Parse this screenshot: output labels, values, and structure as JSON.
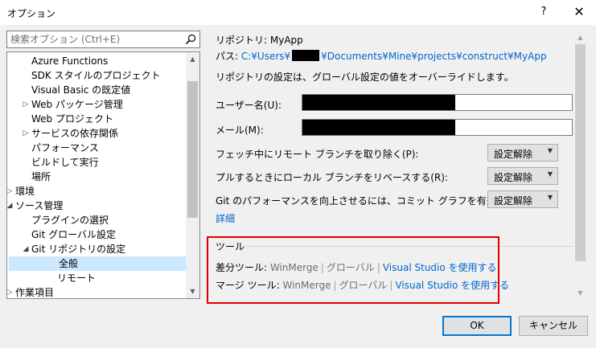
{
  "window": {
    "title": "オプション",
    "help_glyph": "?",
    "close_glyph": "✕"
  },
  "search": {
    "placeholder": "検索オプション (Ctrl+E)"
  },
  "tree": {
    "items": [
      {
        "label": "Azure Functions",
        "indent": 2,
        "expander": "",
        "selected": false
      },
      {
        "label": "SDK スタイルのプロジェクト",
        "indent": 2,
        "expander": "",
        "selected": false
      },
      {
        "label": "Visual Basic の既定値",
        "indent": 2,
        "expander": "",
        "selected": false
      },
      {
        "label": "Web パッケージ管理",
        "indent": 2,
        "expander": "▷",
        "selected": false
      },
      {
        "label": "Web プロジェクト",
        "indent": 2,
        "expander": "",
        "selected": false
      },
      {
        "label": "サービスの依存関係",
        "indent": 2,
        "expander": "▷",
        "selected": false
      },
      {
        "label": "パフォーマンス",
        "indent": 2,
        "expander": "",
        "selected": false
      },
      {
        "label": "ビルドして実行",
        "indent": 2,
        "expander": "",
        "selected": false
      },
      {
        "label": "場所",
        "indent": 2,
        "expander": "",
        "selected": false
      },
      {
        "label": "環境",
        "indent": 1,
        "expander": "▷",
        "selected": false
      },
      {
        "label": "ソース管理",
        "indent": 1,
        "expander": "◢",
        "selected": false
      },
      {
        "label": "プラグインの選択",
        "indent": 2,
        "expander": "",
        "selected": false
      },
      {
        "label": "Git グローバル設定",
        "indent": 2,
        "expander": "",
        "selected": false
      },
      {
        "label": "Git リポジトリの設定",
        "indent": 2,
        "expander": "◢",
        "selected": false
      },
      {
        "label": "全般",
        "indent": 3,
        "expander": "",
        "selected": true
      },
      {
        "label": "リモート",
        "indent": 3,
        "expander": "",
        "selected": false
      },
      {
        "label": "作業項目",
        "indent": 1,
        "expander": "▷",
        "selected": false
      }
    ]
  },
  "repo": {
    "repository_line": "リポジトリ: MyApp",
    "path_label": "パス:",
    "path_prefix": "C:¥Users¥",
    "path_suffix": "¥Documents¥Mine¥projects¥construct¥MyApp",
    "override_note": "リポジトリの設定は、グローバル設定の値をオーバーライドします。",
    "user_name_label": "ユーザー名(U):",
    "email_label": "メール(M):",
    "fetch_prune_label": "フェッチ中にリモート ブランチを取り除く(P):",
    "pull_rebase_label": "プルするときにローカル ブランチをリベースする(R):",
    "commit_graph_label": "Git のパフォーマンスを向上させるには、コミット グラフを有効にします(E):",
    "unset_value": "設定解除",
    "details_link": "詳細"
  },
  "tools": {
    "section_label": "ツール",
    "diff_label": "差分ツール:",
    "merge_label": "マージ ツール:",
    "tool_name": "WinMerge",
    "scope": "グローバル",
    "use_vs_link": "Visual Studio を使用する"
  },
  "buttons": {
    "ok": "OK",
    "cancel": "キャンセル"
  },
  "colors": {
    "link": "#0066cc",
    "highlight_border": "#e00000",
    "selection": "#cce8ff",
    "default_button_border": "#0078d7"
  }
}
